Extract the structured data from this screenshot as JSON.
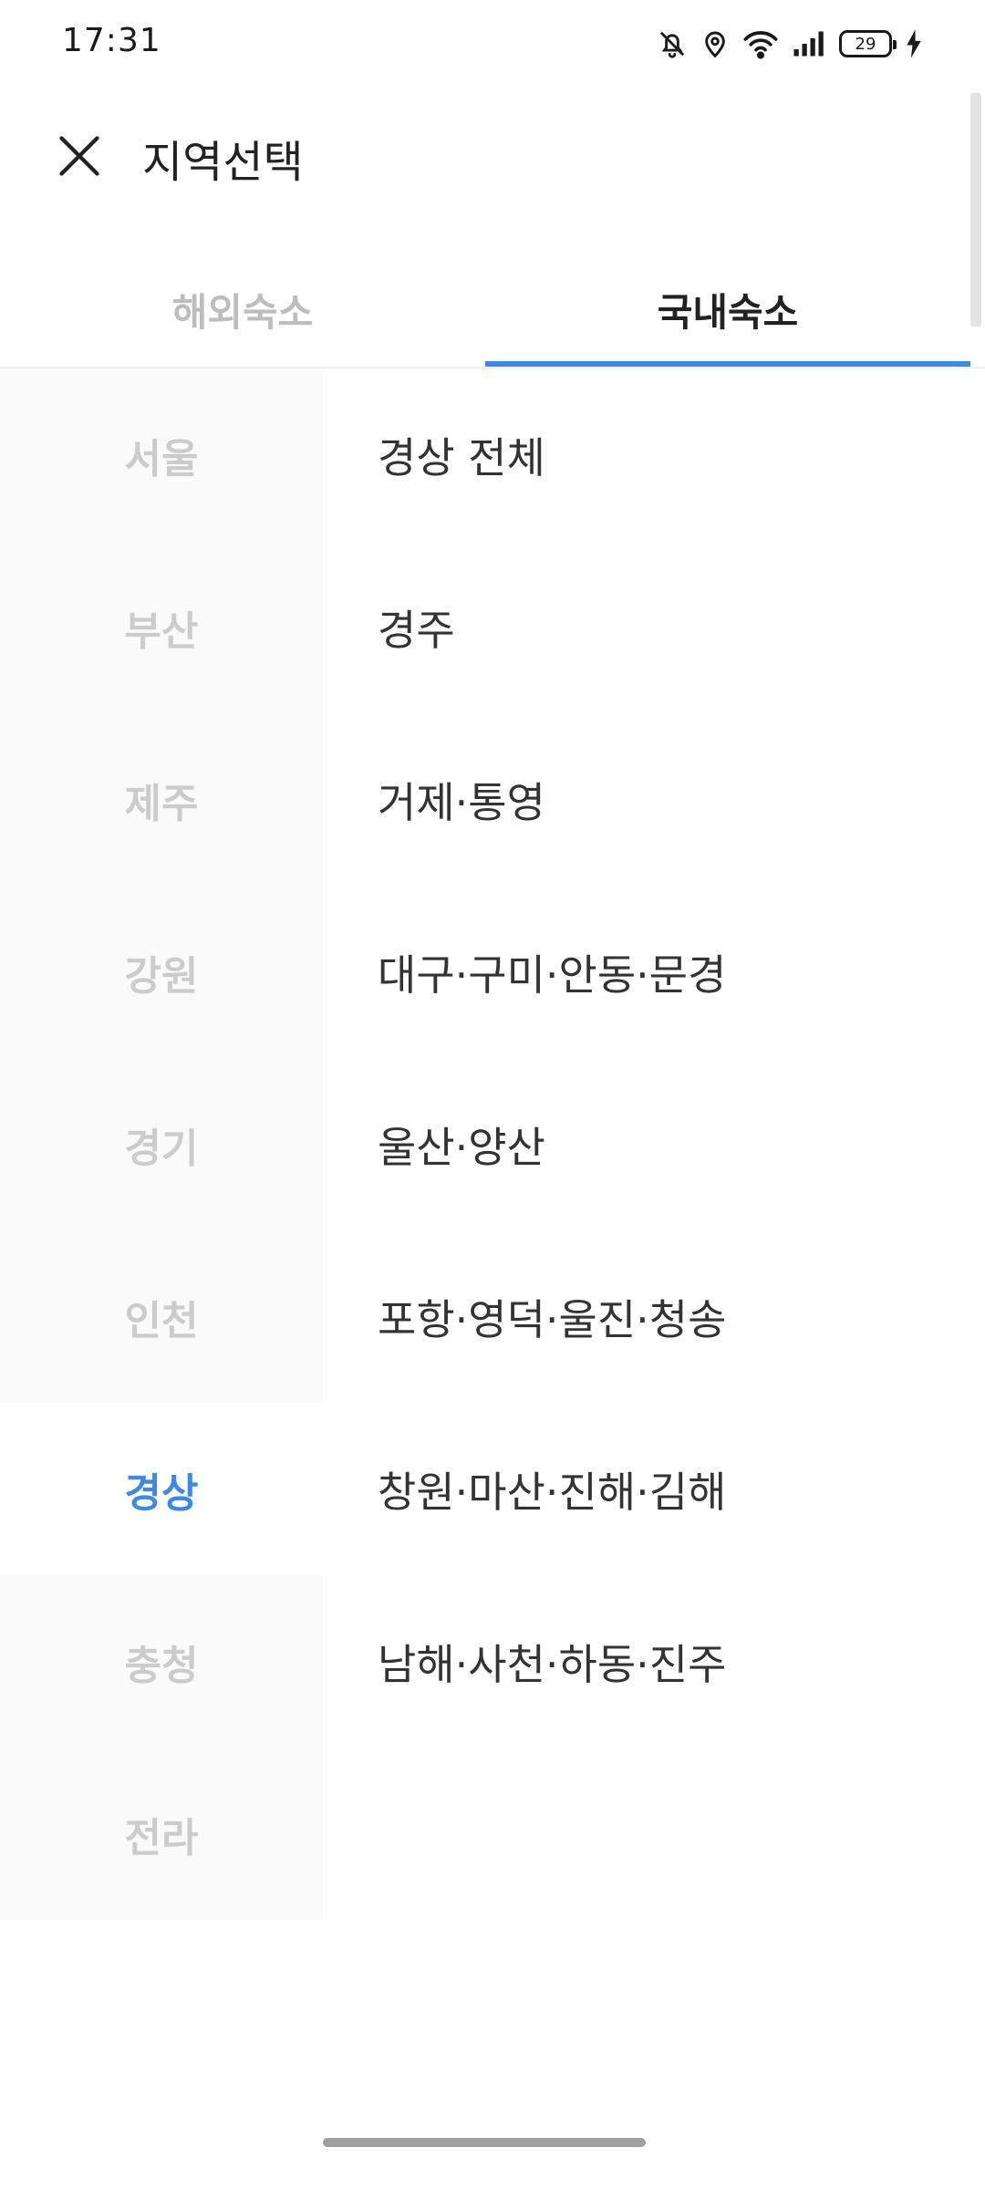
{
  "status_bar": {
    "time": "17:31",
    "battery": "29",
    "icons": [
      "bell-off-icon",
      "location-icon",
      "wifi-icon",
      "signal-icon",
      "battery-icon",
      "charging-icon"
    ]
  },
  "header": {
    "title": "지역선택",
    "close_icon": "close-icon"
  },
  "tabs": [
    {
      "label": "해외숙소",
      "active": false
    },
    {
      "label": "국내숙소",
      "active": true
    }
  ],
  "regions": [
    {
      "label": "서울",
      "selected": false
    },
    {
      "label": "부산",
      "selected": false
    },
    {
      "label": "제주",
      "selected": false
    },
    {
      "label": "강원",
      "selected": false
    },
    {
      "label": "경기",
      "selected": false
    },
    {
      "label": "인천",
      "selected": false
    },
    {
      "label": "경상",
      "selected": true
    },
    {
      "label": "충청",
      "selected": false
    },
    {
      "label": "전라",
      "selected": false
    }
  ],
  "subregions": [
    {
      "label": "경상 전체"
    },
    {
      "label": "경주"
    },
    {
      "label": "거제·통영"
    },
    {
      "label": "대구·구미·안동·문경"
    },
    {
      "label": "울산·양산"
    },
    {
      "label": "포항·영덕·울진·청송"
    },
    {
      "label": "창원·마산·진해·김해"
    },
    {
      "label": "남해·사천·하동·진주"
    }
  ],
  "colors": {
    "accent": "#3d8ae0",
    "inactive_text": "#cccccc",
    "left_bg": "#fafafa"
  }
}
